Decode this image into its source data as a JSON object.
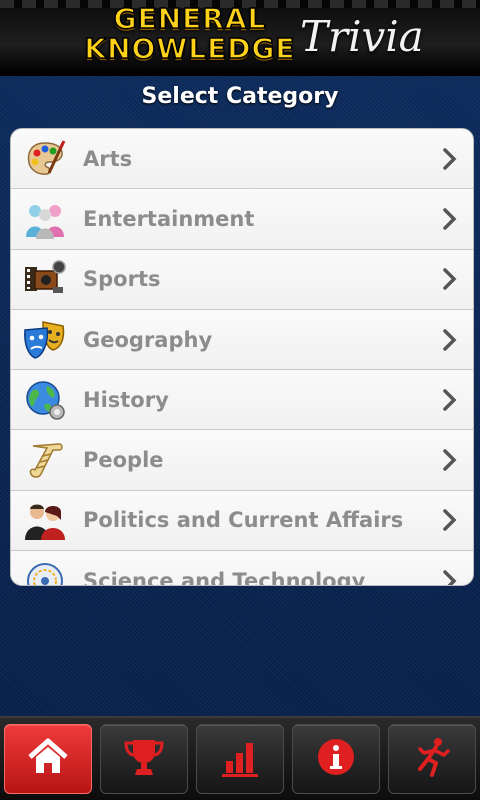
{
  "header": {
    "logo_line1": "GENERAL",
    "logo_line2": "KNOWLEDGE",
    "logo_script": "Trivia"
  },
  "title": "Select Category",
  "categories": [
    {
      "label": "Arts",
      "icon": "palette-icon"
    },
    {
      "label": "Entertainment",
      "icon": "people-icon"
    },
    {
      "label": "Sports",
      "icon": "film-camera-icon"
    },
    {
      "label": "Geography",
      "icon": "theater-masks-icon"
    },
    {
      "label": "History",
      "icon": "globe-icon"
    },
    {
      "label": "People",
      "icon": "scroll-icon"
    },
    {
      "label": "Politics and Current Affairs",
      "icon": "couple-icon"
    },
    {
      "label": "Science and Technology",
      "icon": "science-icon"
    }
  ],
  "nav": [
    {
      "name": "home",
      "icon": "home-icon",
      "active": true
    },
    {
      "name": "trophy",
      "icon": "trophy-icon",
      "active": false
    },
    {
      "name": "stats",
      "icon": "bar-chart-icon",
      "active": false
    },
    {
      "name": "info",
      "icon": "info-icon",
      "active": false
    },
    {
      "name": "exit",
      "icon": "running-man-icon",
      "active": false
    }
  ],
  "colors": {
    "accent": "#e02020",
    "logo_yellow": "#ffd21a",
    "list_text": "#8c8c8c"
  }
}
